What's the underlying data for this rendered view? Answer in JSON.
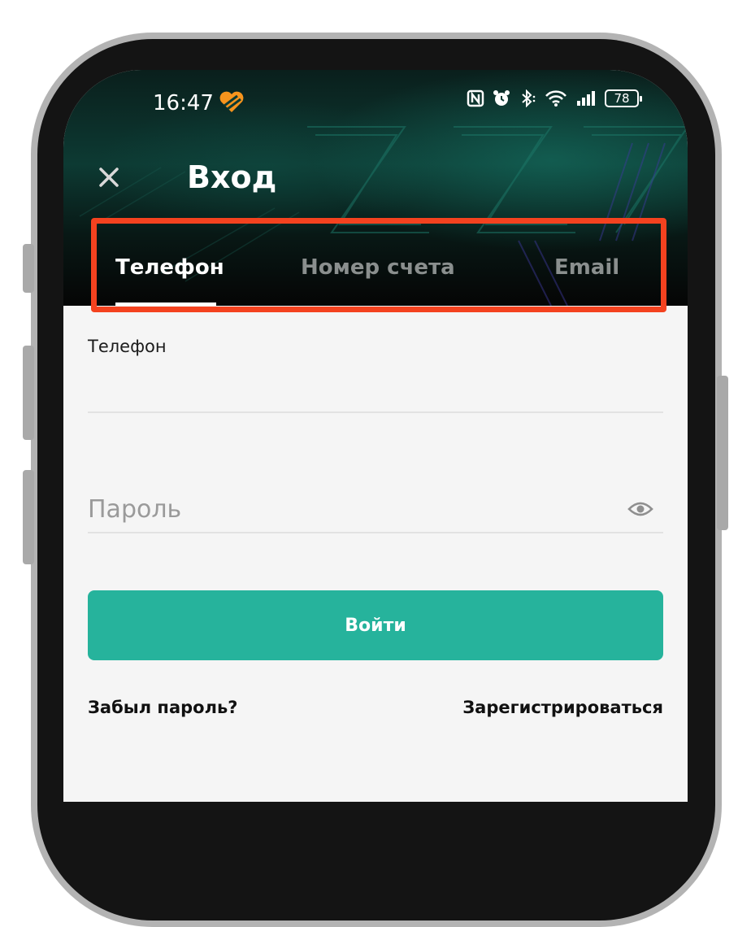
{
  "status_bar": {
    "time": "16:47",
    "battery": "78",
    "icons": [
      "heart-split-icon",
      "nfc-icon",
      "alarm-icon",
      "bluetooth-icon",
      "wifi-icon",
      "signal-icon",
      "battery-icon"
    ]
  },
  "header": {
    "title": "Вход",
    "close_icon": "close-icon"
  },
  "tabs": [
    {
      "label": "Телефон",
      "active": true
    },
    {
      "label": "Номер счета",
      "active": false
    },
    {
      "label": "Email",
      "active": false
    }
  ],
  "form": {
    "phone_label": "Телефон",
    "phone_value": "",
    "password_placeholder": "Пароль",
    "password_value": "",
    "submit_label": "Войти"
  },
  "links": {
    "forgot": "Забыл пароль?",
    "register": "Зарегистрироваться"
  },
  "colors": {
    "accent": "#26b39c",
    "highlight": "#f4421f",
    "header_dark": "#0a1f1c",
    "background": "#f5f5f5"
  }
}
